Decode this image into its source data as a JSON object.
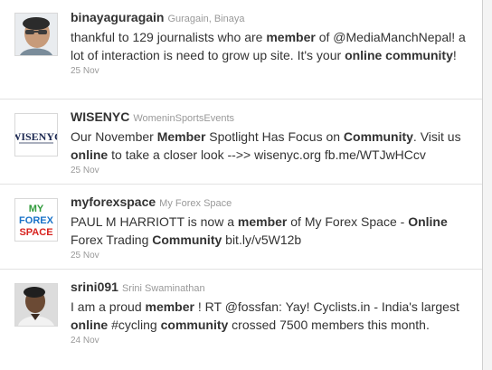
{
  "tweets": [
    {
      "username": "binayaguragain",
      "fullname": "Guragain, Binaya",
      "text_parts": [
        "thankful to 129 journalists who are ",
        "member",
        " of ",
        "@MediaManchNepal",
        "! a lot of interaction is need to grow up site. It's your ",
        "online community",
        "!"
      ],
      "time": "25 Nov"
    },
    {
      "username": "WISENYC",
      "fullname": "WomeninSportsEvents",
      "text_parts": [
        "Our November ",
        "Member",
        " Spotlight Has Focus on ",
        "Community",
        ". Visit us ",
        "online",
        " to take a closer look -->> ",
        "wisenyc.org",
        " ",
        "fb.me/WTJwHCcv"
      ],
      "time": "25 Nov"
    },
    {
      "username": "myforexspace",
      "fullname": "My Forex Space",
      "text_parts": [
        "PAUL M HARRIOTT is now a ",
        "member",
        " of My Forex Space - ",
        "Online",
        " Forex Trading ",
        "Community",
        " ",
        "bit.ly/v5W12b"
      ],
      "time": "25 Nov"
    },
    {
      "username": "srini091",
      "fullname": "Srini Swaminathan",
      "text_parts": [
        "I am a proud ",
        "member",
        " ! RT ",
        "@fossfan",
        ": Yay! Cyclists.in - India's largest ",
        "online",
        " ",
        "#cycling",
        " ",
        "community",
        " crossed 7500 members this month."
      ],
      "time": "24 Nov"
    }
  ],
  "avatars": {
    "wisenyc_logo_text": "WISENYC",
    "forex_logo_lines": [
      "MY",
      "FOREX",
      "SPACE"
    ]
  },
  "colors": {
    "username": "#333333",
    "meta": "#999999",
    "divider": "#e2e2e2",
    "forex_blue": "#1a73c8",
    "forex_red": "#d8231f",
    "forex_green": "#2f9a3a",
    "wisenyc_navy": "#1e2a52"
  }
}
